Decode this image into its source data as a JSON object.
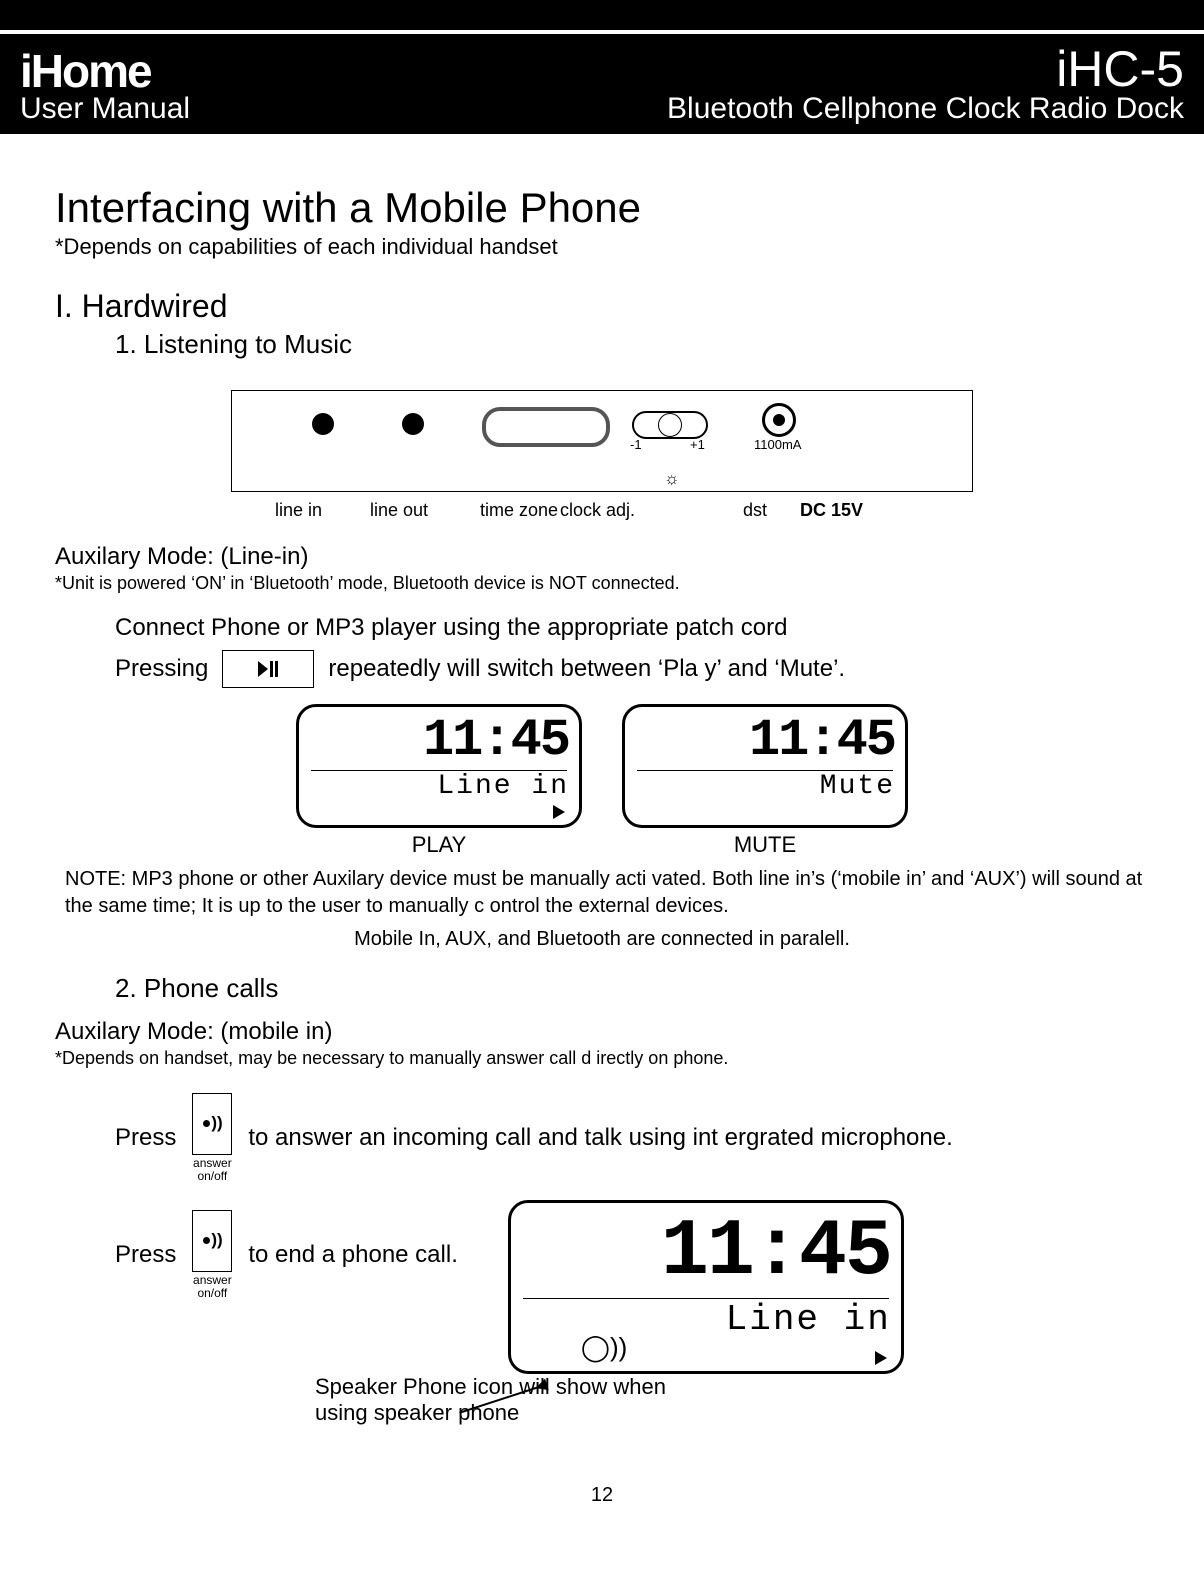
{
  "header": {
    "brand": "iHome",
    "model": "iHC-5",
    "manual": "User Manual",
    "product": "Bluetooth Cellphone Clock Radio Dock"
  },
  "h1": "Interfacing with a Mobile Phone",
  "h1_sub": "*Depends on capabilities of each individual handset",
  "secI": "I. Hardwired",
  "step1": "1. Listening to Music",
  "back": {
    "linein": "line in",
    "lineout": "line out",
    "tz": "time zone",
    "clock": "clock adj.",
    "minus": "-1",
    "plus": "+1",
    "dst": "dst",
    "ma": "1100mA",
    "dc": "DC 15V"
  },
  "aux1_title": "Auxilary Mode: (Line-in)",
  "aux1_sub": "*Unit is powered ‘ON’ in ‘Bluetooth’ mode, Bluetooth device is   NOT connected.",
  "connect": "Connect Phone or MP3 player using the appropriate patch cord",
  "press": "Pressing",
  "press_tail": "repeatedly will switch between ‘Pla y’ and ‘Mute’.",
  "lcd": {
    "time": "11:45",
    "linein": "Line in",
    "mute": "Mute",
    "play_cap": "PLAY",
    "mute_cap": "MUTE"
  },
  "note1": "NOTE:  MP3 phone or other Auxilary device must be manually acti        vated.  Both line in’s (‘mobile in’ and ‘AUX’) will sound at the same time; It is up to the user to manually c         ontrol the external devices.",
  "center": "Mobile In, AUX, and Bluetooth are connected in paralell.",
  "step2": "2. Phone calls",
  "aux2_title": "Auxilary Mode: (mobile in)",
  "aux2_sub": "*Depends on handset, may be necessary to manually answer call d irectly on phone.",
  "press_word": "Press",
  "answer_txt": "to answer an incoming call and talk using int ergrated microphone.",
  "end_txt": "to end a phone call.",
  "ans_label": "answer\non/off",
  "spk_note": "Speaker Phone icon will show when using speaker phone",
  "pagenum": "12"
}
